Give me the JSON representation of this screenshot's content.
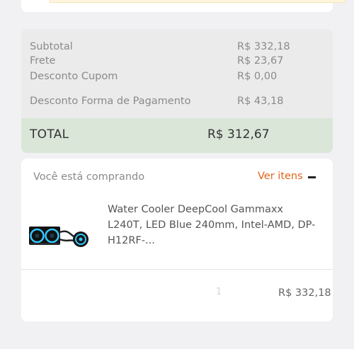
{
  "summary": {
    "subtotal_label": "Subtotal",
    "subtotal_value": "R$ 332,18",
    "frete_label": "Frete",
    "frete_value": "R$ 23,67",
    "cupom_label": "Desconto Cupom",
    "cupom_value": "R$ 0,00",
    "pagamento_label": "Desconto Forma de Pagamento",
    "pagamento_value": "R$ 43,18",
    "total_label": "TOTAL",
    "total_value": "R$ 312,67"
  },
  "cart": {
    "heading": "Você está comprando",
    "toggle_label": "Ver itens",
    "items": [
      {
        "name": "Water Cooler DeepCool Gammaxx L240T, LED Blue 240mm, Intel-AMD, DP-H12RF-...",
        "quantity": "1",
        "price": "R$ 332,18"
      }
    ]
  },
  "colors": {
    "accent": "#e0641d",
    "total_bg": "#d9e6d8",
    "summary_bg": "#ebebeb",
    "led_blue": "#33c8ff"
  },
  "icons": [
    "minus-icon",
    "water-cooler-image"
  ]
}
